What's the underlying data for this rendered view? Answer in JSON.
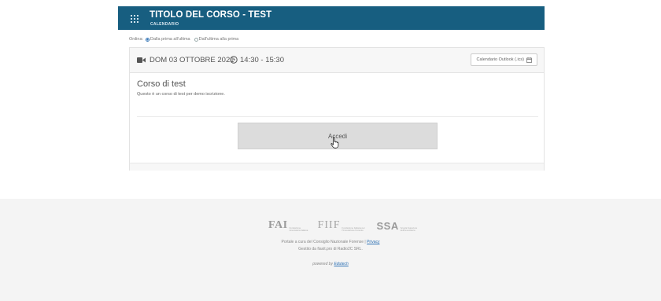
{
  "header": {
    "title": "TITOLO DEL CORSO - TEST",
    "subtitle": "CALENDARIO",
    "bg_color": "#175e80"
  },
  "order": {
    "label": "Ordina:",
    "options": [
      {
        "label": "Dalla prima all'ultima",
        "selected": true
      },
      {
        "label": "Dall'ultima alla prima",
        "selected": false
      }
    ]
  },
  "event": {
    "icon": "video-camera-icon",
    "date": "DOM 03 OTTOBRE 2021",
    "time": "14:30 - 15:30",
    "calendar_button": "Calendario Outlook (.ics)",
    "course_title": "Corso di test",
    "course_description": "Questo è un corso di test per demo iscrizione.",
    "access_button": "Accedi"
  },
  "footer": {
    "logos": [
      {
        "name": "FAI",
        "fine": "Fondazione Avvocatura Italiana"
      },
      {
        "name": "FIIF",
        "fine": "Fondazione Italiana per l'Innovazione Forense"
      },
      {
        "name": "SSA",
        "fine": "Scuola Superiore dell'Avvocatura"
      }
    ],
    "line1_text": "Portale a cura del Consiglio Nazionale Forense | ",
    "privacy_link": "Privacy",
    "line2": "Gestito da fiaxit.pro di Radio2C SRL.",
    "powered_text": "powered by ",
    "powered_link": "Edutech"
  }
}
